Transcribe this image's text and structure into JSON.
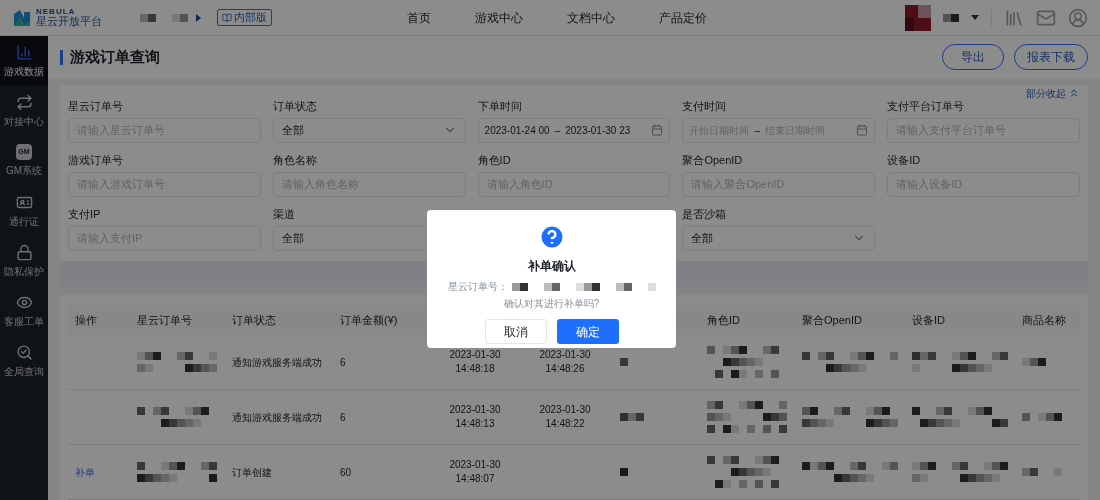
{
  "header": {
    "logo_top": "NEBULA",
    "logo_bottom": "星云开放平台",
    "badge": "内部版",
    "nav": [
      {
        "label": "首页"
      },
      {
        "label": "游戏中心"
      },
      {
        "label": "文档中心"
      },
      {
        "label": "产品定价"
      }
    ]
  },
  "sidebar": {
    "items": [
      {
        "label": "游戏数据",
        "selected": true
      },
      {
        "label": "对接中心",
        "selected": false
      },
      {
        "label": "GM系统",
        "icon_text": "GM",
        "selected": false
      },
      {
        "label": "通行证",
        "selected": false
      },
      {
        "label": "隐私保护",
        "selected": false
      },
      {
        "label": "客服工单",
        "selected": false
      },
      {
        "label": "全局查询",
        "selected": false
      }
    ]
  },
  "page": {
    "title": "游戏订单查询",
    "buttons": [
      "导出",
      "报表下载"
    ]
  },
  "filters": {
    "collapse": "部分收起",
    "fields": [
      {
        "label": "星云订单号",
        "kind": "text",
        "placeholder": "请输入星云订单号"
      },
      {
        "label": "订单状态",
        "kind": "select",
        "value": "全部"
      },
      {
        "label": "下单时间",
        "kind": "range",
        "start": "2023-01-24 00",
        "separator": "–",
        "end": "2023-01-30 23"
      },
      {
        "label": "支付时间",
        "kind": "range",
        "start_placeholder": "开始日期时间",
        "separator": "–",
        "end_placeholder": "结束日期时间"
      },
      {
        "label": "支付平台订单号",
        "kind": "text",
        "placeholder": "请输入支付平台订单号"
      },
      {
        "label": "游戏订单号",
        "kind": "text",
        "placeholder": "请输入游戏订单号"
      },
      {
        "label": "角色名称",
        "kind": "text",
        "placeholder": "请输入角色名称"
      },
      {
        "label": "角色ID",
        "kind": "text",
        "placeholder": "请输入角色ID"
      },
      {
        "label": "聚合OpenID",
        "kind": "text",
        "placeholder": "请输入聚合OpenID"
      },
      {
        "label": "设备ID",
        "kind": "text",
        "placeholder": "请输入设备ID"
      },
      {
        "label": "支付IP",
        "kind": "text",
        "placeholder": "请输入支付IP"
      },
      {
        "label": "渠道",
        "kind": "select",
        "value": "全部"
      },
      {
        "label": "是否沙箱",
        "kind": "select",
        "value": "全部"
      }
    ]
  },
  "table": {
    "columns": [
      "操作",
      "星云订单号",
      "订单状态",
      "订单金额(¥)",
      "角色ID",
      "聚合OpenID",
      "设备ID",
      "商品名称"
    ],
    "rows": [
      {
        "status": "通知游戏服务端成功",
        "amount": "6",
        "order_time": [
          "2023-01-30",
          "14:48:18"
        ],
        "pay_time": [
          "2023-01-30",
          "14:48:26"
        ]
      },
      {
        "status": "通知游戏服务端成功",
        "amount": "6",
        "order_time": [
          "2023-01-30",
          "14:48:13"
        ],
        "pay_time": [
          "2023-01-30",
          "14:48:22"
        ]
      },
      {
        "action": "补单",
        "status": "订单创建",
        "amount": "60",
        "order_time": [
          "2023-01-30",
          "14:48:07"
        ]
      }
    ]
  },
  "dialog": {
    "title": "补单确认",
    "order_label": "星云订单号：",
    "message": "确认对其进行补单吗?",
    "buttons": [
      {
        "label": "取消",
        "kind": "secondary"
      },
      {
        "label": "确定",
        "kind": "primary"
      }
    ]
  }
}
